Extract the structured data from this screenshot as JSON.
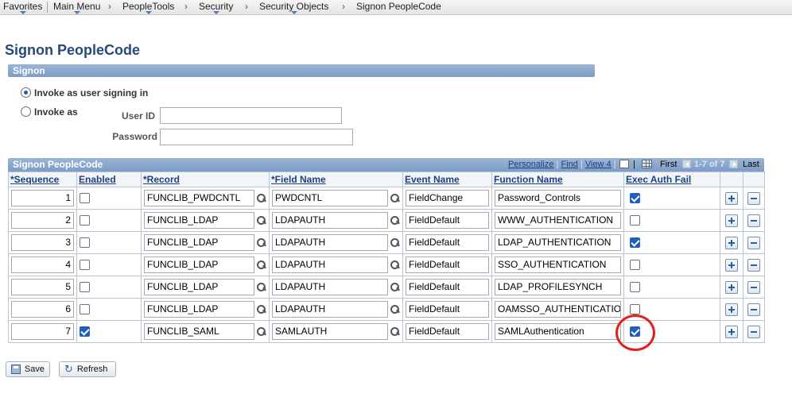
{
  "breadcrumb": [
    "Favorites",
    "Main Menu",
    "PeopleTools",
    "Security",
    "Security Objects",
    "Signon PeopleCode"
  ],
  "page_title": "Signon PeopleCode",
  "signon_group": {
    "title": "Signon",
    "radio_user_signing": "Invoke as user signing in",
    "radio_invoke_as": "Invoke as",
    "userid_label": "User ID",
    "password_label": "Password",
    "userid_value": "",
    "password_value": ""
  },
  "grid": {
    "title": "Signon PeopleCode",
    "nav": {
      "personalize": "Personalize",
      "find": "Find",
      "view": "View 4",
      "first": "First",
      "range": "1-7 of 7",
      "last": "Last"
    },
    "columns": [
      "*Sequence",
      "Enabled",
      "*Record",
      "*Field Name",
      "Event Name",
      "Function Name",
      "Exec Auth Fail"
    ],
    "rows": [
      {
        "sequence": "1",
        "enabled": false,
        "record": "FUNCLIB_PWDCNTL",
        "field": "PWDCNTL",
        "event": "FieldChange",
        "function": "Password_Controls",
        "exec_auth_fail": true
      },
      {
        "sequence": "2",
        "enabled": false,
        "record": "FUNCLIB_LDAP",
        "field": "LDAPAUTH",
        "event": "FieldDefault",
        "function": "WWW_AUTHENTICATION",
        "exec_auth_fail": false
      },
      {
        "sequence": "3",
        "enabled": false,
        "record": "FUNCLIB_LDAP",
        "field": "LDAPAUTH",
        "event": "FieldDefault",
        "function": "LDAP_AUTHENTICATION",
        "exec_auth_fail": true
      },
      {
        "sequence": "4",
        "enabled": false,
        "record": "FUNCLIB_LDAP",
        "field": "LDAPAUTH",
        "event": "FieldDefault",
        "function": "SSO_AUTHENTICATION",
        "exec_auth_fail": false
      },
      {
        "sequence": "5",
        "enabled": false,
        "record": "FUNCLIB_LDAP",
        "field": "LDAPAUTH",
        "event": "FieldDefault",
        "function": "LDAP_PROFILESYNCH",
        "exec_auth_fail": false
      },
      {
        "sequence": "6",
        "enabled": false,
        "record": "FUNCLIB_LDAP",
        "field": "LDAPAUTH",
        "event": "FieldDefault",
        "function": "OAMSSO_AUTHENTICATIO",
        "exec_auth_fail": false
      },
      {
        "sequence": "7",
        "enabled": true,
        "record": "FUNCLIB_SAML",
        "field": "SAMLAUTH",
        "event": "FieldDefault",
        "function": "SAMLAuthentication",
        "exec_auth_fail": true
      }
    ]
  },
  "buttons": {
    "save": "Save",
    "refresh": "Refresh"
  },
  "colors": {
    "accent": "#27487a",
    "header_blue": "#8aa6cd",
    "highlight_red": "#e51e1e"
  }
}
